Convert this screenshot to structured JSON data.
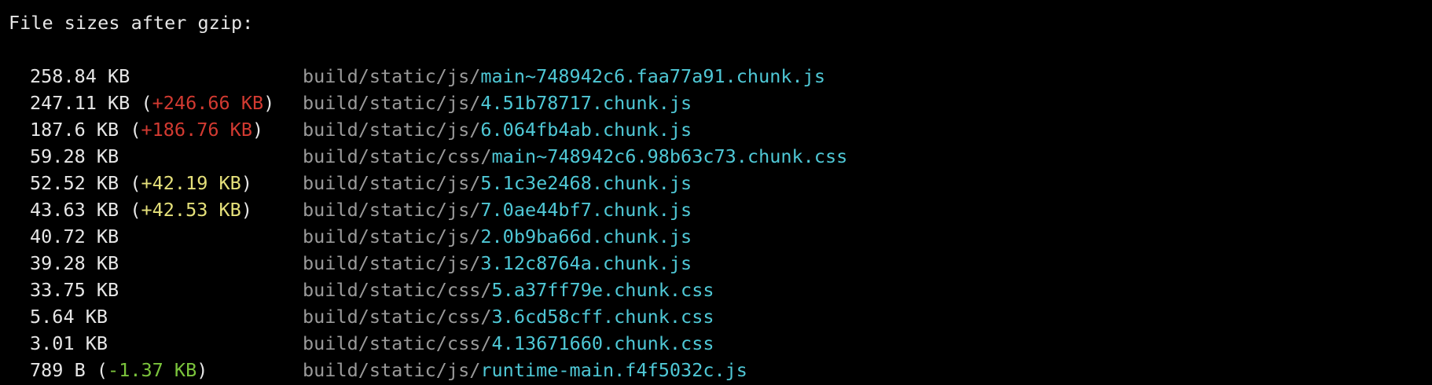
{
  "colors": {
    "background": "#000000",
    "text": "#e6e6e6",
    "dir": "#9a9a9a",
    "file": "#4fc8d6",
    "red": "#d23a31",
    "yellow": "#e5e07a",
    "green": "#7bc43c"
  },
  "header": "File sizes after gzip:",
  "rows": [
    {
      "size": "258.84 KB",
      "diff": "",
      "diff_color": "",
      "dir": "build/static/js/",
      "file": "main~748942c6.faa77a91.chunk.js"
    },
    {
      "size": "247.11 KB",
      "diff": "+246.66 KB",
      "diff_color": "red",
      "dir": "build/static/js/",
      "file": "4.51b78717.chunk.js"
    },
    {
      "size": "187.6 KB",
      "diff": "+186.76 KB",
      "diff_color": "red",
      "dir": "build/static/js/",
      "file": "6.064fb4ab.chunk.js"
    },
    {
      "size": "59.28 KB",
      "diff": "",
      "diff_color": "",
      "dir": "build/static/css/",
      "file": "main~748942c6.98b63c73.chunk.css"
    },
    {
      "size": "52.52 KB",
      "diff": "+42.19 KB",
      "diff_color": "yellow",
      "dir": "build/static/js/",
      "file": "5.1c3e2468.chunk.js"
    },
    {
      "size": "43.63 KB",
      "diff": "+42.53 KB",
      "diff_color": "yellow",
      "dir": "build/static/js/",
      "file": "7.0ae44bf7.chunk.js"
    },
    {
      "size": "40.72 KB",
      "diff": "",
      "diff_color": "",
      "dir": "build/static/js/",
      "file": "2.0b9ba66d.chunk.js"
    },
    {
      "size": "39.28 KB",
      "diff": "",
      "diff_color": "",
      "dir": "build/static/js/",
      "file": "3.12c8764a.chunk.js"
    },
    {
      "size": "33.75 KB",
      "diff": "",
      "diff_color": "",
      "dir": "build/static/css/",
      "file": "5.a37ff79e.chunk.css"
    },
    {
      "size": "5.64 KB",
      "diff": "",
      "diff_color": "",
      "dir": "build/static/css/",
      "file": "3.6cd58cff.chunk.css"
    },
    {
      "size": "3.01 KB",
      "diff": "",
      "diff_color": "",
      "dir": "build/static/css/",
      "file": "4.13671660.chunk.css"
    },
    {
      "size": "789 B",
      "diff": "-1.37 KB",
      "diff_color": "green",
      "dir": "build/static/js/",
      "file": "runtime-main.f4f5032c.js"
    }
  ]
}
